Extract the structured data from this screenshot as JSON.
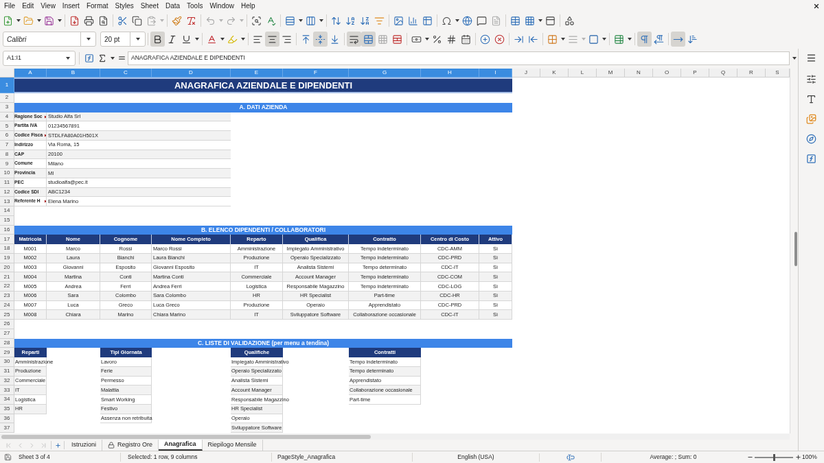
{
  "menu_bar": {
    "items": [
      "File",
      "Edit",
      "View",
      "Insert",
      "Format",
      "Styles",
      "Sheet",
      "Data",
      "Tools",
      "Window",
      "Help"
    ]
  },
  "format_toolbar": {
    "font_name": "Calibri",
    "font_size": "20 pt",
    "button_groups": [
      [
        {
          "kind": "bold",
          "pressed": true
        },
        {
          "kind": "italic",
          "pressed": false
        },
        {
          "kind": "underline",
          "pressed": false
        }
      ],
      [
        {
          "kind": "font_color",
          "pressed": false
        },
        {
          "kind": "highlight",
          "pressed": false
        }
      ],
      [
        {
          "kind": "align_left",
          "pressed": false
        },
        {
          "kind": "align_center",
          "pressed": true
        },
        {
          "kind": "align_right",
          "pressed": false
        }
      ],
      [
        {
          "kind": "align_top",
          "pressed": false
        },
        {
          "kind": "align_middle",
          "pressed": true
        },
        {
          "kind": "align_bottom",
          "pressed": false
        }
      ],
      [
        {
          "kind": "wrap_text",
          "pressed": true
        },
        {
          "kind": "merge_center",
          "pressed": true
        },
        {
          "kind": "merge_cells",
          "pressed": false
        },
        {
          "kind": "unmerge_cells",
          "pressed": false
        }
      ],
      [
        {
          "kind": "currency",
          "pressed": false
        },
        {
          "kind": "percent",
          "pressed": false
        },
        {
          "kind": "number",
          "pressed": false
        },
        {
          "kind": "date",
          "pressed": false
        }
      ],
      [
        {
          "kind": "add_decimal",
          "pressed": false
        },
        {
          "kind": "delete_decimal",
          "pressed": false
        }
      ],
      [
        {
          "kind": "increase_indent",
          "pressed": false
        },
        {
          "kind": "decrease_indent",
          "pressed": false
        }
      ],
      [
        {
          "kind": "borders",
          "pressed": false
        },
        {
          "kind": "border_style",
          "pressed": false
        },
        {
          "kind": "border_color",
          "pressed": false
        }
      ],
      [
        {
          "kind": "conditional",
          "pressed": false
        }
      ],
      [
        {
          "kind": "left_to_right",
          "pressed": true
        },
        {
          "kind": "right_to_left",
          "pressed": false
        }
      ],
      [
        {
          "kind": "horizontal_text",
          "pressed": true
        },
        {
          "kind": "vertical_text",
          "pressed": false
        }
      ]
    ]
  },
  "formula_bar": {
    "name_box": "A1:I1",
    "content": "ANAGRAFICA AZIENDALE E DIPENDENTI"
  },
  "sheet": {
    "columns": [
      {
        "label": "A",
        "selected": true
      },
      {
        "label": "B",
        "selected": true
      },
      {
        "label": "C",
        "selected": true
      },
      {
        "label": "D",
        "selected": true
      },
      {
        "label": "E",
        "selected": true
      },
      {
        "label": "F",
        "selected": true
      },
      {
        "label": "G",
        "selected": true
      },
      {
        "label": "H",
        "selected": true
      },
      {
        "label": "I",
        "selected": true
      },
      {
        "label": "J",
        "selected": false
      },
      {
        "label": "K",
        "selected": false
      },
      {
        "label": "L",
        "selected": false
      },
      {
        "label": "M",
        "selected": false
      },
      {
        "label": "N",
        "selected": false
      },
      {
        "label": "O",
        "selected": false
      },
      {
        "label": "P",
        "selected": false
      },
      {
        "label": "Q",
        "selected": false
      },
      {
        "label": "R",
        "selected": false
      },
      {
        "label": "S",
        "selected": false
      }
    ],
    "rows": [
      {
        "label": "1",
        "selected": true
      },
      {
        "label": "2",
        "selected": false
      },
      {
        "label": "3",
        "selected": false
      },
      {
        "label": "4",
        "selected": false
      },
      {
        "label": "5",
        "selected": false
      },
      {
        "label": "6",
        "selected": false
      },
      {
        "label": "7",
        "selected": false
      },
      {
        "label": "8",
        "selected": false
      },
      {
        "label": "9",
        "selected": false
      },
      {
        "label": "10",
        "selected": false
      },
      {
        "label": "11",
        "selected": false
      },
      {
        "label": "12",
        "selected": false
      },
      {
        "label": "13",
        "selected": false
      },
      {
        "label": "14",
        "selected": false
      },
      {
        "label": "15",
        "selected": false
      },
      {
        "label": "16",
        "selected": false
      },
      {
        "label": "17",
        "selected": false
      },
      {
        "label": "18",
        "selected": false
      },
      {
        "label": "19",
        "selected": false
      },
      {
        "label": "20",
        "selected": false
      },
      {
        "label": "21",
        "selected": false
      },
      {
        "label": "22",
        "selected": false
      },
      {
        "label": "23",
        "selected": false
      },
      {
        "label": "24",
        "selected": false
      },
      {
        "label": "25",
        "selected": false
      },
      {
        "label": "26",
        "selected": false
      },
      {
        "label": "27",
        "selected": false
      },
      {
        "label": "28",
        "selected": false
      },
      {
        "label": "29",
        "selected": false
      },
      {
        "label": "30",
        "selected": false
      },
      {
        "label": "31",
        "selected": false
      },
      {
        "label": "32",
        "selected": false
      },
      {
        "label": "33",
        "selected": false
      },
      {
        "label": "34",
        "selected": false
      },
      {
        "label": "35",
        "selected": false
      },
      {
        "label": "36",
        "selected": false
      },
      {
        "label": "37",
        "selected": false
      }
    ],
    "title": "ANAGRAFICA AZIENDALE E DIPENDENTI",
    "company": {
      "heading": "A. DATI AZIENDA",
      "fields": [
        {
          "label": "Ragione Soc",
          "overflow": true,
          "value": "Studio Alfa Srl"
        },
        {
          "label": "Partita IVA",
          "overflow": false,
          "value": "01234567891"
        },
        {
          "label": "Codice Fisca",
          "overflow": true,
          "value": "STDLFA80A01H501X"
        },
        {
          "label": "Indirizzo",
          "overflow": false,
          "value": "Via Roma, 15"
        },
        {
          "label": "CAP",
          "overflow": false,
          "value": "20100"
        },
        {
          "label": "Comune",
          "overflow": false,
          "value": "Milano"
        },
        {
          "label": "Provincia",
          "overflow": false,
          "value": "MI"
        },
        {
          "label": "PEC",
          "overflow": false,
          "value": "studioalfa@pec.it"
        },
        {
          "label": "Codice SDI",
          "overflow": false,
          "value": "ABC1234"
        },
        {
          "label": "Referente H",
          "overflow": true,
          "value": "Elena Marino"
        }
      ]
    },
    "employees": {
      "heading": "B. ELENCO DIPENDENTI / COLLABORATORI",
      "columns": [
        "Matricola",
        "Nome",
        "Cognome",
        "Nome Completo",
        "Reparto",
        "Qualifica",
        "Contratto",
        "Centro di Costo",
        "Attivo"
      ],
      "rows": [
        [
          "M001",
          "Marco",
          "Rossi",
          "Marco Rossi",
          "Amministrazione",
          "Impiegato Amministrativo",
          "Tempo indeterminato",
          "CDC-AMM",
          "Sì"
        ],
        [
          "M002",
          "Laura",
          "Bianchi",
          "Laura Bianchi",
          "Produzione",
          "Operaio Specializzato",
          "Tempo indeterminato",
          "CDC-PRD",
          "Sì"
        ],
        [
          "M003",
          "Giovanni",
          "Esposito",
          "Giovanni Esposito",
          "IT",
          "Analista Sistemi",
          "Tempo determinato",
          "CDC-IT",
          "Sì"
        ],
        [
          "M004",
          "Martina",
          "Conti",
          "Martina Conti",
          "Commerciale",
          "Account Manager",
          "Tempo indeterminato",
          "CDC-COM",
          "Sì"
        ],
        [
          "M005",
          "Andrea",
          "Ferri",
          "Andrea Ferri",
          "Logistica",
          "Responsabile Magazzino",
          "Tempo indeterminato",
          "CDC-LOG",
          "Sì"
        ],
        [
          "M006",
          "Sara",
          "Colombo",
          "Sara Colombo",
          "HR",
          "HR Specialist",
          "Part-time",
          "CDC-HR",
          "Sì"
        ],
        [
          "M007",
          "Luca",
          "Greco",
          "Luca Greco",
          "Produzione",
          "Operaio",
          "Apprendistato",
          "CDC-PRD",
          "Sì"
        ],
        [
          "M008",
          "Chiara",
          "Marino",
          "Chiara Marino",
          "IT",
          "Sviluppatore Software",
          "Collaborazione occasionale",
          "CDC-IT",
          "Sì"
        ]
      ]
    },
    "validation_lists": {
      "heading": "C. LISTE DI VALIDAZIONE (per menu a tendina)",
      "lists": [
        {
          "title": "Reparti",
          "items": [
            "Amministrazione",
            "Produzione",
            "Commerciale",
            "IT",
            "Logistica",
            "HR"
          ]
        },
        {
          "title": "Tipi Giornata",
          "items": [
            "Lavoro",
            "Ferie",
            "Permesso",
            "Malattia",
            "Smart Working",
            "Festivo",
            "Assenza non retribuita"
          ]
        },
        {
          "title": "Qualifiche",
          "items": [
            "Impiegato Amministrativo",
            "Operaio Specializzato",
            "Analista Sistemi",
            "Account Manager",
            "Responsabile Magazzino",
            "HR Specialist",
            "Operaio",
            "Sviluppatore Software"
          ]
        },
        {
          "title": "Contratti",
          "items": [
            "Tempo indeterminato",
            "Tempo determinato",
            "Apprendistato",
            "Collaborazione occasionale",
            "Part-time"
          ]
        }
      ]
    }
  },
  "sheet_tabs": [
    {
      "label": "Istruzioni",
      "selected": false,
      "protected": false
    },
    {
      "label": "Registro Ore",
      "selected": false,
      "protected": true
    },
    {
      "label": "Anagrafica",
      "selected": true,
      "protected": false
    },
    {
      "label": "Riepilogo Mensile",
      "selected": false,
      "protected": false
    }
  ],
  "status_bar": {
    "sheet_position": "Sheet 3 of 4",
    "selection": "Selected: 1 row, 9 columns",
    "page_style": "PageStyle_Anagrafica",
    "language": "English (USA)",
    "summary": "Average: ; Sum: 0",
    "zoom": {
      "level": 0.5,
      "reading": "100%"
    }
  }
}
